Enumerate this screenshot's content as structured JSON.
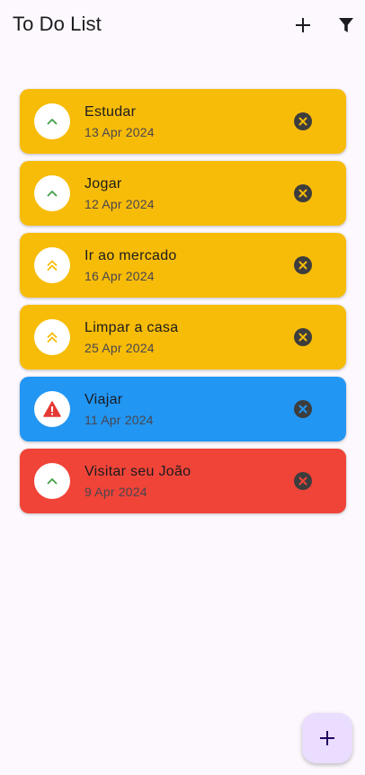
{
  "app_bar": {
    "title": "To Do List",
    "add_icon": "plus-icon",
    "filter_icon": "filter-icon"
  },
  "colors": {
    "background": "#fcf8fd",
    "amber": "#f7bc08",
    "blue": "#2196f3",
    "red": "#f04438",
    "low_priority_icon": "#43a047",
    "medium_priority_icon": "#f7bc08",
    "high_priority_icon": "#e53935",
    "remove_icon": "#3d3d3d",
    "fab": "#eaddff"
  },
  "tasks": [
    {
      "name": "Estudar",
      "date": "13 Apr 2024",
      "color": "amber",
      "priority_icon": "chevron-up-icon",
      "remove_icon": "close-circle-icon"
    },
    {
      "name": "Jogar",
      "date": "12 Apr 2024",
      "color": "amber",
      "priority_icon": "chevron-up-icon",
      "remove_icon": "close-circle-icon"
    },
    {
      "name": "Ir ao mercado",
      "date": "16 Apr 2024",
      "color": "amber",
      "priority_icon": "double-chevron-up-icon",
      "remove_icon": "close-circle-icon"
    },
    {
      "name": "Limpar a casa",
      "date": "25 Apr 2024",
      "color": "amber",
      "priority_icon": "double-chevron-up-icon",
      "remove_icon": "close-circle-icon"
    },
    {
      "name": "Viajar",
      "date": "11 Apr 2024",
      "color": "blue",
      "priority_icon": "warning-icon",
      "remove_icon": "close-circle-icon"
    },
    {
      "name": "Visitar seu João",
      "date": "9 Apr 2024",
      "color": "red",
      "priority_icon": "chevron-up-icon",
      "remove_icon": "close-circle-icon"
    }
  ],
  "fab": {
    "icon": "plus-icon"
  }
}
